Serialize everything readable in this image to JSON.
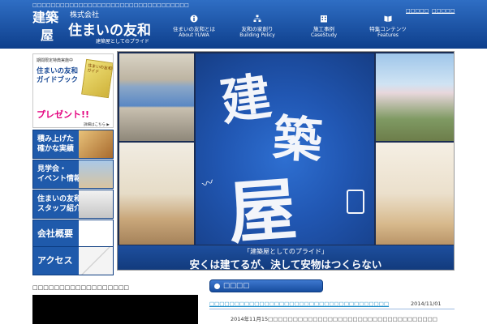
{
  "header": {
    "tagline": "□□□□□□□□□□□□□□□□□□□□□□□□□□□□□□□□□□",
    "logo_line1": "建築",
    "logo_line2": "屋",
    "company_prefix": "株式会社",
    "company_name": "住まいの友和",
    "company_sub": "建築屋としてのプライド",
    "top_links": [
      "□□□□□",
      "□□□□□"
    ],
    "nav": [
      {
        "jp": "住まいの友和とは",
        "en": "About YUWA",
        "icon": "info-icon"
      },
      {
        "jp": "友和の家創り",
        "en": "Building Policy",
        "icon": "hierarchy-icon"
      },
      {
        "jp": "施工事例",
        "en": "CaseStudy",
        "icon": "building-icon"
      },
      {
        "jp": "特集コンテンツ",
        "en": "Features",
        "icon": "book-icon"
      }
    ]
  },
  "sidebar": {
    "guide": {
      "small": "期間限定特典実施中",
      "title_line1": "住まいの友和",
      "title_line2": "ガイドブック",
      "book_text": "住まいの友和ガイド",
      "present": "プレゼント!!",
      "link": "詳細はこちら ▶"
    },
    "banners": [
      {
        "line1": "積み上げた",
        "line2": "確かな実績"
      },
      {
        "line1": "見学会・",
        "line2": "イベント情報"
      },
      {
        "line1": "住まいの友和",
        "line2": "スタッフ紹介"
      },
      {
        "line1": "会社概要",
        "line2": ""
      },
      {
        "line1": "アクセス",
        "line2": ""
      }
    ]
  },
  "hero": {
    "callig_1": "建",
    "callig_2": "築",
    "callig_3": "屋",
    "caption_small": "「建築屋としてのプライド」",
    "caption_large": "安くは建てるが、決して安物はつくらない"
  },
  "bottom": {
    "left_heading": "□□□□□□□□□□□□□□□□□□",
    "news_tab_label": "□□□□",
    "news_title": "□□□□□□□□□□□□□□□□□□□□□□□□□□□□□□□□□□□□",
    "news_date": "2014/11/01",
    "news_excerpt": "2014年11月15□□□□□□□□□□□□□□□□□□□□□□□□□□□□□□□□□□"
  },
  "colors": {
    "header_top": "#2f6ec4",
    "header_bottom": "#0e3f8c",
    "banner_blue": "#1f5aab",
    "present_pink": "#e4007f",
    "link_blue": "#1f8ec9"
  }
}
